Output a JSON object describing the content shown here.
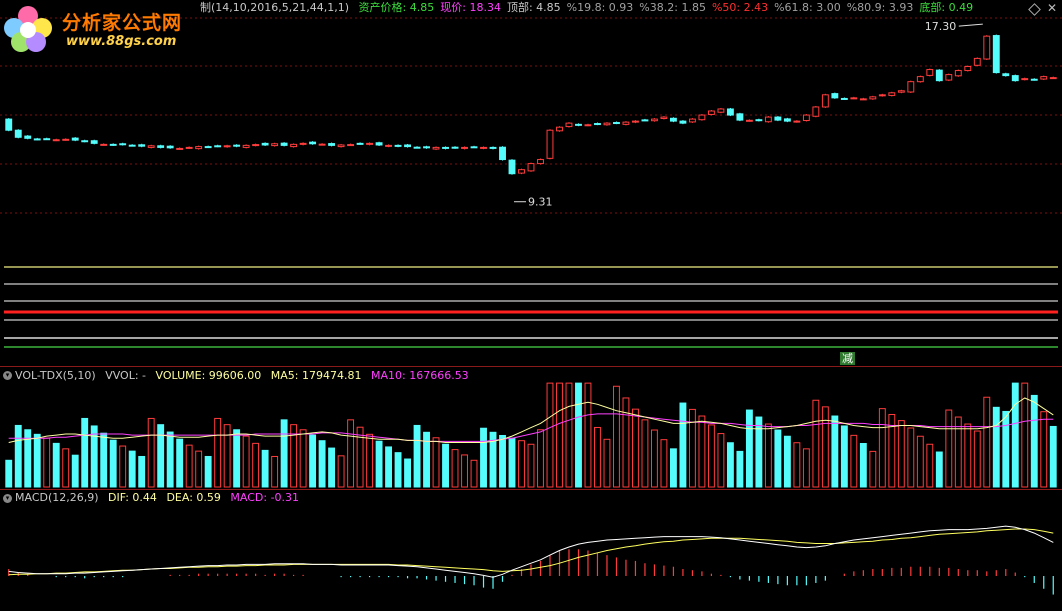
{
  "logo": {
    "title": "分析家公式网",
    "url": "www.88gs.com"
  },
  "price_header": {
    "formula": "制(14,10,2016,5,21,44,1,1)",
    "items": [
      {
        "label": "资产价格:",
        "value": "4.85",
        "color": "#3cdc3c"
      },
      {
        "label": "现价:",
        "value": "18.34",
        "color": "#ff40ff"
      },
      {
        "label": "顶部:",
        "value": "4.85",
        "color": "#c8c8c8"
      },
      {
        "label": "%19.8:",
        "value": "0.93",
        "color": "#a0a0a0"
      },
      {
        "label": "%38.2:",
        "value": "1.85",
        "color": "#a0a0a0"
      },
      {
        "label": "%50:",
        "value": "2.43",
        "color": "#ff3030"
      },
      {
        "label": "%61.8:",
        "value": "3.00",
        "color": "#a0a0a0"
      },
      {
        "label": "%80.9:",
        "value": "3.93",
        "color": "#a0a0a0"
      },
      {
        "label": "底部:",
        "value": "0.49",
        "color": "#3cdc3c"
      }
    ],
    "high_label": "17.30",
    "low_label": "9.31",
    "signal_label": "减"
  },
  "volume_header": {
    "name": "VOL-TDX(5,10)",
    "vvol": "VVOL: -",
    "volume": "VOLUME: 99606.00",
    "ma5": "MA5: 179474.81",
    "ma10": "MA10: 167666.53"
  },
  "macd_header": {
    "name": "MACD(12,26,9)",
    "dif": "DIF: 0.44",
    "dea": "DEA: 0.59",
    "macd": "MACD: -0.31"
  },
  "colors": {
    "up": "#ff3c3c",
    "down": "#54fcfc",
    "ma5": "#ffffa0",
    "ma10": "#ff40ff",
    "grid": "#7a1010",
    "level1": "#c8c86e",
    "level2": "#aaaaaa",
    "level3": "#c85a5a",
    "level4": "#ff2020",
    "level5": "#8888ff",
    "level6": "#dddddd",
    "level7": "#3cb43c"
  },
  "chart_data": {
    "type": "candlestick",
    "close": [
      12.45,
      12.1,
      12.05,
      12.0,
      12.02,
      11.98,
      12.0,
      11.96,
      11.9,
      11.8,
      11.75,
      11.72,
      11.74,
      11.7,
      11.66,
      11.68,
      11.6,
      11.58,
      11.55,
      11.6,
      11.64,
      11.62,
      11.66,
      11.68,
      11.66,
      11.7,
      11.74,
      11.72,
      11.78,
      11.7,
      11.75,
      11.8,
      11.78,
      11.76,
      11.7,
      11.72,
      11.74,
      11.78,
      11.8,
      11.72,
      11.7,
      11.66,
      11.64,
      11.6,
      11.58,
      11.6,
      11.55,
      11.58,
      11.6,
      11.62,
      11.6,
      11.55,
      11.0,
      10.3,
      10.5,
      10.8,
      11.0,
      12.45,
      12.6,
      12.8,
      12.7,
      12.72,
      12.75,
      12.8,
      12.8,
      12.85,
      12.9,
      12.95,
      13.0,
      13.1,
      12.9,
      12.8,
      13.0,
      13.2,
      13.4,
      13.5,
      13.2,
      12.95,
      12.94,
      12.93,
      13.1,
      12.95,
      12.9,
      12.9,
      13.2,
      13.6,
      14.2,
      14.05,
      14.0,
      14.05,
      14.0,
      14.1,
      14.2,
      14.3,
      14.4,
      14.85,
      15.1,
      15.45,
      14.9,
      15.2,
      15.4,
      15.6,
      16.0,
      17.1,
      15.3,
      15.15,
      14.9,
      15.0,
      14.95,
      15.1,
      15.05
    ],
    "ma5": [
      0.42,
      0.44,
      0.45,
      0.46,
      0.48,
      0.49,
      0.5,
      0.5,
      0.49,
      0.48,
      0.47,
      0.46,
      0.46,
      0.47,
      0.48,
      0.49,
      0.49,
      0.48,
      0.47,
      0.47,
      0.47,
      0.48,
      0.49,
      0.49,
      0.5,
      0.5,
      0.49,
      0.48,
      0.48,
      0.48,
      0.49,
      0.5,
      0.51,
      0.52,
      0.51,
      0.49,
      0.48,
      0.47,
      0.46,
      0.45,
      0.45,
      0.45,
      0.44,
      0.44,
      0.43,
      0.43,
      0.42,
      0.42,
      0.42,
      0.42,
      0.42,
      0.43,
      0.45,
      0.48,
      0.52,
      0.56,
      0.6,
      0.66,
      0.72,
      0.76,
      0.78,
      0.8,
      0.78,
      0.75,
      0.72,
      0.7,
      0.68,
      0.66,
      0.64,
      0.62,
      0.6,
      0.6,
      0.61,
      0.62,
      0.61,
      0.6,
      0.58,
      0.56,
      0.55,
      0.55,
      0.55,
      0.56,
      0.57,
      0.58,
      0.6,
      0.62,
      0.63,
      0.62,
      0.6,
      0.58,
      0.57,
      0.56,
      0.56,
      0.57,
      0.58,
      0.58,
      0.57,
      0.56,
      0.55,
      0.55,
      0.55,
      0.55,
      0.55,
      0.56,
      0.58,
      0.66,
      0.78,
      0.84,
      0.8,
      0.74,
      0.68
    ],
    "ma10": [
      0.46,
      0.46,
      0.46,
      0.46,
      0.46,
      0.47,
      0.47,
      0.48,
      0.49,
      0.5,
      0.5,
      0.5,
      0.5,
      0.49,
      0.49,
      0.49,
      0.49,
      0.49,
      0.49,
      0.49,
      0.49,
      0.49,
      0.49,
      0.49,
      0.49,
      0.49,
      0.5,
      0.5,
      0.5,
      0.5,
      0.5,
      0.5,
      0.5,
      0.51,
      0.51,
      0.51,
      0.5,
      0.49,
      0.48,
      0.47,
      0.46,
      0.45,
      0.44,
      0.44,
      0.43,
      0.43,
      0.43,
      0.43,
      0.43,
      0.43,
      0.43,
      0.44,
      0.45,
      0.46,
      0.48,
      0.5,
      0.52,
      0.56,
      0.6,
      0.63,
      0.66,
      0.68,
      0.69,
      0.69,
      0.69,
      0.68,
      0.67,
      0.66,
      0.65,
      0.64,
      0.63,
      0.62,
      0.61,
      0.61,
      0.6,
      0.6,
      0.6,
      0.59,
      0.58,
      0.58,
      0.57,
      0.57,
      0.57,
      0.58,
      0.58,
      0.59,
      0.6,
      0.6,
      0.6,
      0.6,
      0.6,
      0.59,
      0.59,
      0.58,
      0.58,
      0.58,
      0.58,
      0.57,
      0.57,
      0.57,
      0.57,
      0.57,
      0.57,
      0.57,
      0.57,
      0.58,
      0.6,
      0.62,
      0.63,
      0.64,
      0.64
    ],
    "dif": [
      0.08,
      0.06,
      0.05,
      0.04,
      0.04,
      0.04,
      0.04,
      0.05,
      0.05,
      0.06,
      0.07,
      0.08,
      0.09,
      0.1,
      0.11,
      0.12,
      0.13,
      0.14,
      0.15,
      0.16,
      0.17,
      0.18,
      0.18,
      0.19,
      0.19,
      0.2,
      0.2,
      0.2,
      0.21,
      0.21,
      0.21,
      0.21,
      0.2,
      0.2,
      0.2,
      0.19,
      0.19,
      0.19,
      0.19,
      0.19,
      0.19,
      0.18,
      0.17,
      0.16,
      0.14,
      0.12,
      0.1,
      0.08,
      0.06,
      0.04,
      0.01,
      -0.02,
      0.03,
      0.1,
      0.16,
      0.22,
      0.28,
      0.36,
      0.44,
      0.5,
      0.55,
      0.58,
      0.6,
      0.62,
      0.63,
      0.64,
      0.65,
      0.66,
      0.67,
      0.68,
      0.68,
      0.68,
      0.68,
      0.68,
      0.67,
      0.66,
      0.64,
      0.62,
      0.6,
      0.58,
      0.56,
      0.54,
      0.52,
      0.5,
      0.49,
      0.5,
      0.52,
      0.56,
      0.59,
      0.62,
      0.64,
      0.66,
      0.68,
      0.7,
      0.72,
      0.74,
      0.76,
      0.78,
      0.79,
      0.8,
      0.8,
      0.8,
      0.81,
      0.82,
      0.84,
      0.86,
      0.84,
      0.8,
      0.74,
      0.66,
      0.58
    ],
    "dea": [
      0.02,
      0.03,
      0.03,
      0.04,
      0.04,
      0.05,
      0.05,
      0.06,
      0.07,
      0.07,
      0.08,
      0.09,
      0.1,
      0.1,
      0.11,
      0.12,
      0.13,
      0.13,
      0.14,
      0.15,
      0.15,
      0.16,
      0.16,
      0.17,
      0.17,
      0.18,
      0.18,
      0.19,
      0.19,
      0.19,
      0.2,
      0.2,
      0.2,
      0.2,
      0.2,
      0.2,
      0.2,
      0.2,
      0.2,
      0.2,
      0.2,
      0.19,
      0.19,
      0.18,
      0.17,
      0.16,
      0.15,
      0.14,
      0.13,
      0.12,
      0.11,
      0.09,
      0.08,
      0.09,
      0.1,
      0.12,
      0.15,
      0.18,
      0.22,
      0.27,
      0.32,
      0.36,
      0.4,
      0.44,
      0.47,
      0.5,
      0.52,
      0.55,
      0.57,
      0.59,
      0.6,
      0.62,
      0.63,
      0.64,
      0.65,
      0.65,
      0.65,
      0.65,
      0.64,
      0.63,
      0.62,
      0.61,
      0.6,
      0.58,
      0.57,
      0.56,
      0.56,
      0.56,
      0.57,
      0.58,
      0.59,
      0.6,
      0.62,
      0.63,
      0.65,
      0.66,
      0.68,
      0.7,
      0.72,
      0.73,
      0.74,
      0.75,
      0.76,
      0.78,
      0.79,
      0.8,
      0.81,
      0.81,
      0.8,
      0.77,
      0.74
    ]
  }
}
